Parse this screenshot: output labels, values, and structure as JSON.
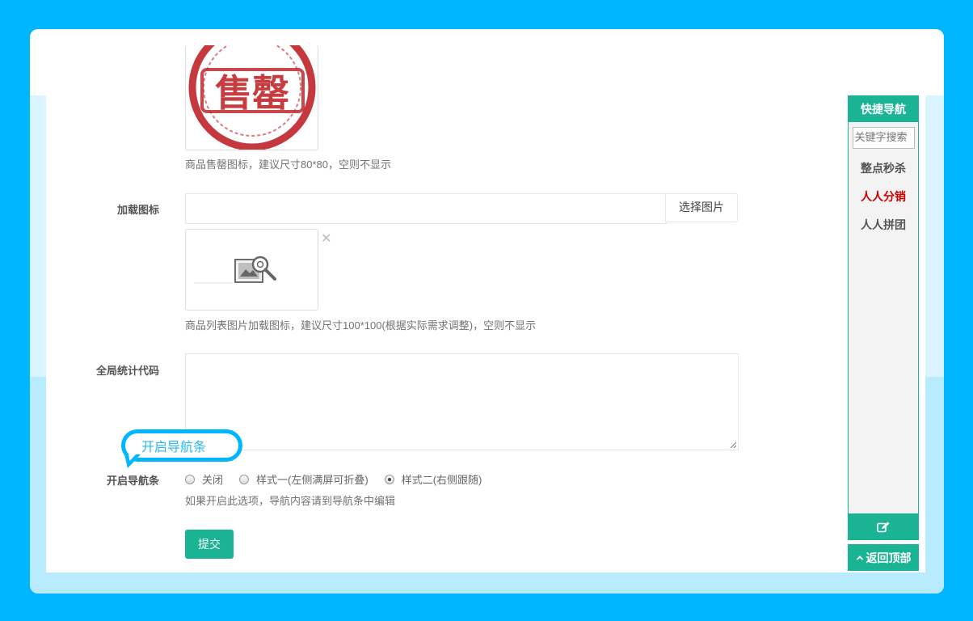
{
  "form": {
    "sold_icon_help": "商品售罄图标，建议尺寸80*80，空则不显示",
    "sold_stamp_text": "售罄",
    "loading_icon": {
      "label": "加载图标",
      "input_value": "",
      "pick_button": "选择图片",
      "remove_glyph": "✕",
      "help": "商品列表图片加载图标，建议尺寸100*100(根据实际需求调整)，空则不显示"
    },
    "stats_code": {
      "label": "全局统计代码",
      "value": ""
    },
    "nav_bar": {
      "label": "开启导航条",
      "options": [
        {
          "label": "关闭",
          "checked": false
        },
        {
          "label": "样式一(左侧满屏可折叠)",
          "checked": false
        },
        {
          "label": "样式二(右侧跟随)",
          "checked": true
        }
      ],
      "help": "如果开启此选项，导航内容请到导航条中编辑"
    },
    "submit_label": "提交"
  },
  "tooltip": {
    "text": "开启导航条"
  },
  "quick_nav": {
    "title": "快捷导航",
    "search_placeholder": "关键字搜索",
    "items": [
      {
        "label": "整点秒杀",
        "color": "#555555"
      },
      {
        "label": "人人分销",
        "color": "#cc0000"
      },
      {
        "label": "人人拼团",
        "color": "#555555"
      }
    ],
    "edit_icon": "edit-icon",
    "back_to_top": "返回顶部"
  },
  "colors": {
    "page_bg": "#00b6ff",
    "accent": "#1ab394",
    "stamp_red": "#c0272d",
    "tooltip_border": "#00b6ff"
  }
}
